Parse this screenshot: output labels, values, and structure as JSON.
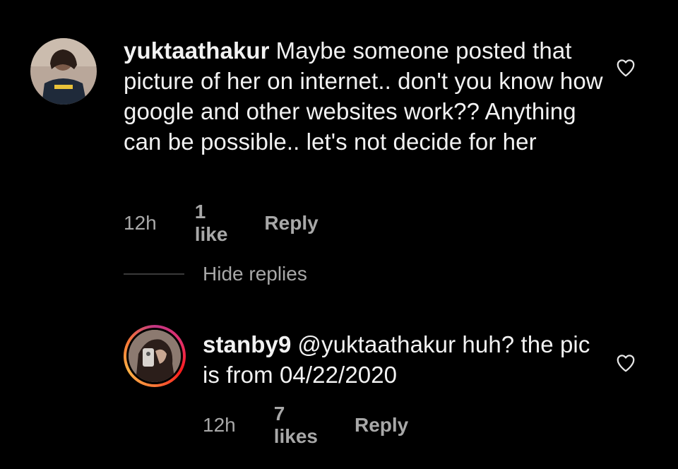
{
  "comments": [
    {
      "username": "yuktaathakur",
      "body": "Maybe someone posted that picture of her on internet.. don't you know how google and other websites work?? Anything can be possible.. let's not decide for her",
      "time": "12h",
      "likes": "1 like",
      "reply": "Reply"
    }
  ],
  "replies_toggle": "Hide replies",
  "replies": [
    {
      "username": "stanby9",
      "body": "@yuktaathakur huh? the pic is from 04/22/2020",
      "time": "12h",
      "likes": "7 likes",
      "reply": "Reply"
    }
  ],
  "icons": {
    "like": "heart-outline-icon"
  }
}
